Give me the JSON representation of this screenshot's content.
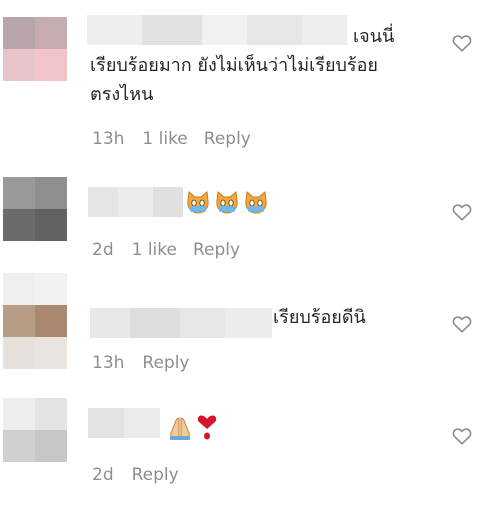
{
  "comments": [
    {
      "text": "เจนนี่\nเรียบร้อยมาก ยังไม่เห็นว่าไม่เรียบร้อย\nตรงไหน",
      "time": "13h",
      "likes": "1 like",
      "reply": "Reply"
    },
    {
      "text": "",
      "emoji": [
        "cat-face-icon",
        "cat-face-icon",
        "cat-face-icon"
      ],
      "time": "2d",
      "likes": "1 like",
      "reply": "Reply"
    },
    {
      "text": "เรียบร้อยดีนิ",
      "time": "13h",
      "likes": "",
      "reply": "Reply"
    },
    {
      "text": "",
      "emoji": [
        "folded-hands-icon",
        "heart-exclamation-icon"
      ],
      "time": "2d",
      "likes": "",
      "reply": "Reply"
    }
  ],
  "colors": {
    "text": "#262626",
    "meta": "#8e8e8e",
    "heart_outline": "#8e8e8e"
  }
}
